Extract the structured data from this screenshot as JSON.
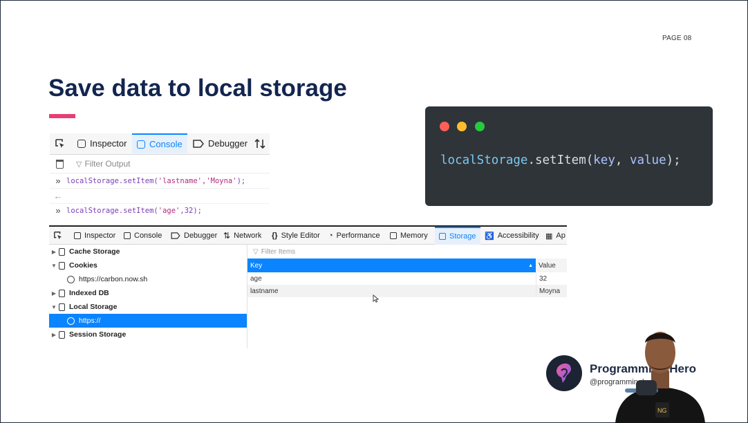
{
  "slide": {
    "page_label": "PAGE 08",
    "title": "Save data to local storage"
  },
  "console_panel": {
    "tabs": [
      {
        "label": "Inspector",
        "icon": "inspector-icon"
      },
      {
        "label": "Console",
        "icon": "console-icon",
        "active": true
      },
      {
        "label": "Debugger",
        "icon": "debugger-icon"
      }
    ],
    "filter_placeholder": "Filter Output",
    "lines": [
      {
        "code_fn": "localStorage.setItem(",
        "code_args": "'lastname','Moyna'",
        "code_end": ");"
      },
      {
        "code_fn": "localStorage.setItem(",
        "code_args": "'age'",
        "code_rest": ",32);"
      }
    ]
  },
  "code_card": {
    "code_object": "localStorage",
    "code_method": ".setItem(",
    "code_arg1": "key",
    "code_sep": ", ",
    "code_arg2": "value",
    "code_end": ");",
    "dot_colors": [
      "#ff5f56",
      "#ffbd2e",
      "#27c93f"
    ]
  },
  "storage_panel": {
    "tabs": [
      {
        "label": "Inspector"
      },
      {
        "label": "Console"
      },
      {
        "label": "Debugger"
      },
      {
        "label": "Network"
      },
      {
        "label": "Style Editor"
      },
      {
        "label": "Performance"
      },
      {
        "label": "Memory"
      },
      {
        "label": "Storage",
        "active": true
      },
      {
        "label": "Accessibility"
      },
      {
        "label": "Ap"
      }
    ],
    "tree": [
      {
        "label": "Cache Storage"
      },
      {
        "label": "Cookies"
      },
      {
        "label": "https://carbon.now.sh"
      },
      {
        "label": "Indexed DB"
      },
      {
        "label": "Local Storage"
      },
      {
        "label": "https://"
      },
      {
        "label": "Session Storage"
      }
    ],
    "filter_placeholder": "Filter Items",
    "columns": {
      "key": "Key",
      "value": "Value"
    },
    "rows": [
      {
        "key": "age",
        "value": "32"
      },
      {
        "key": "lastname",
        "value": "Moyna"
      }
    ]
  },
  "brand": {
    "name": "Programming Hero",
    "handle": "@programminghero"
  },
  "colors": {
    "title": "#13254f",
    "accent": "#e83e73",
    "selection": "#0a84ff",
    "code_bg": "#2f3439"
  }
}
